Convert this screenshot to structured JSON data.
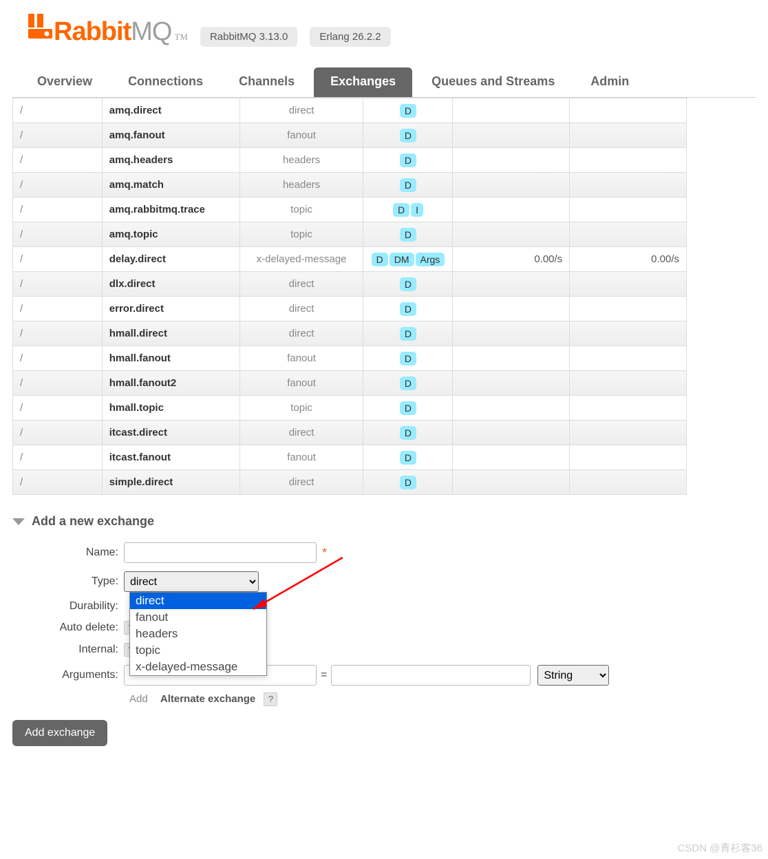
{
  "header": {
    "logo_rabbit": "Rabbit",
    "logo_mq": "MQ",
    "logo_tm": "TM",
    "version_rabbit": "RabbitMQ 3.13.0",
    "version_erlang": "Erlang 26.2.2"
  },
  "tabs": {
    "overview": "Overview",
    "connections": "Connections",
    "channels": "Channels",
    "exchanges": "Exchanges",
    "queues": "Queues and Streams",
    "admin": "Admin"
  },
  "exchanges": [
    {
      "vhost": "/",
      "name": "amq.direct",
      "type": "direct",
      "features": [
        "D"
      ],
      "rate_in": "",
      "rate_out": ""
    },
    {
      "vhost": "/",
      "name": "amq.fanout",
      "type": "fanout",
      "features": [
        "D"
      ],
      "rate_in": "",
      "rate_out": ""
    },
    {
      "vhost": "/",
      "name": "amq.headers",
      "type": "headers",
      "features": [
        "D"
      ],
      "rate_in": "",
      "rate_out": ""
    },
    {
      "vhost": "/",
      "name": "amq.match",
      "type": "headers",
      "features": [
        "D"
      ],
      "rate_in": "",
      "rate_out": ""
    },
    {
      "vhost": "/",
      "name": "amq.rabbitmq.trace",
      "type": "topic",
      "features": [
        "D",
        "I"
      ],
      "rate_in": "",
      "rate_out": ""
    },
    {
      "vhost": "/",
      "name": "amq.topic",
      "type": "topic",
      "features": [
        "D"
      ],
      "rate_in": "",
      "rate_out": ""
    },
    {
      "vhost": "/",
      "name": "delay.direct",
      "type": "x-delayed-message",
      "features": [
        "D",
        "DM",
        "Args"
      ],
      "rate_in": "0.00/s",
      "rate_out": "0.00/s"
    },
    {
      "vhost": "/",
      "name": "dlx.direct",
      "type": "direct",
      "features": [
        "D"
      ],
      "rate_in": "",
      "rate_out": ""
    },
    {
      "vhost": "/",
      "name": "error.direct",
      "type": "direct",
      "features": [
        "D"
      ],
      "rate_in": "",
      "rate_out": ""
    },
    {
      "vhost": "/",
      "name": "hmall.direct",
      "type": "direct",
      "features": [
        "D"
      ],
      "rate_in": "",
      "rate_out": ""
    },
    {
      "vhost": "/",
      "name": "hmall.fanout",
      "type": "fanout",
      "features": [
        "D"
      ],
      "rate_in": "",
      "rate_out": ""
    },
    {
      "vhost": "/",
      "name": "hmall.fanout2",
      "type": "fanout",
      "features": [
        "D"
      ],
      "rate_in": "",
      "rate_out": ""
    },
    {
      "vhost": "/",
      "name": "hmall.topic",
      "type": "topic",
      "features": [
        "D"
      ],
      "rate_in": "",
      "rate_out": ""
    },
    {
      "vhost": "/",
      "name": "itcast.direct",
      "type": "direct",
      "features": [
        "D"
      ],
      "rate_in": "",
      "rate_out": ""
    },
    {
      "vhost": "/",
      "name": "itcast.fanout",
      "type": "fanout",
      "features": [
        "D"
      ],
      "rate_in": "",
      "rate_out": ""
    },
    {
      "vhost": "/",
      "name": "simple.direct",
      "type": "direct",
      "features": [
        "D"
      ],
      "rate_in": "",
      "rate_out": ""
    }
  ],
  "section": {
    "title": "Add a new exchange"
  },
  "form": {
    "labels": {
      "name": "Name:",
      "type": "Type:",
      "durability": "Durability:",
      "auto_delete": "Auto delete:",
      "internal": "Internal:",
      "arguments": "Arguments:"
    },
    "mand": "*",
    "type_selected": "direct",
    "type_options": [
      "direct",
      "fanout",
      "headers",
      "topic",
      "x-delayed-message"
    ],
    "help": "?",
    "args": {
      "eq": "=",
      "type_selected": "String"
    },
    "hints": {
      "add": "Add",
      "alt": "Alternate exchange"
    },
    "submit": "Add exchange"
  },
  "watermark": "CSDN @青衫客36"
}
